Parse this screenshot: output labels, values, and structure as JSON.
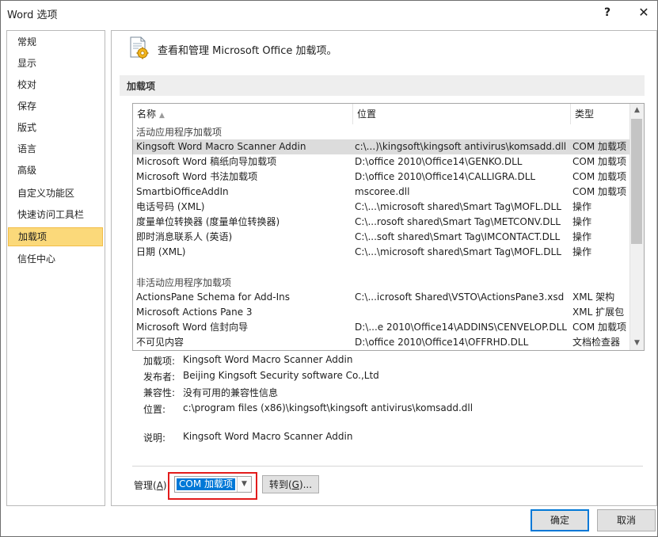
{
  "window": {
    "title": "Word 选项",
    "help": "?",
    "close": "✕"
  },
  "sidebar": {
    "items": [
      {
        "label": "常规"
      },
      {
        "label": "显示"
      },
      {
        "label": "校对"
      },
      {
        "label": "保存"
      },
      {
        "label": "版式"
      },
      {
        "label": "语言"
      },
      {
        "label": "高级"
      },
      {
        "label": "自定义功能区"
      },
      {
        "label": "快速访问工具栏"
      },
      {
        "label": "加载项",
        "selected": true
      },
      {
        "label": "信任中心"
      }
    ]
  },
  "header": {
    "text": "查看和管理 Microsoft Office 加载项。"
  },
  "section": {
    "title": "加载项"
  },
  "table": {
    "columns": {
      "name": "名称",
      "sort_arrow": "▲",
      "location": "位置",
      "type": "类型"
    },
    "groups": [
      {
        "label": "活动应用程序加载项",
        "rows": [
          {
            "name": "Kingsoft Word Macro Scanner Addin",
            "location": "c:\\...)\\kingsoft\\kingsoft antivirus\\komsadd.dll",
            "type": "COM 加载项",
            "highlighted": true
          },
          {
            "name": "Microsoft Word 稿纸向导加载项",
            "location": "D:\\office 2010\\Office14\\GENKO.DLL",
            "type": "COM 加载项"
          },
          {
            "name": "Microsoft Word 书法加载项",
            "location": "D:\\office 2010\\Office14\\CALLIGRA.DLL",
            "type": "COM 加载项"
          },
          {
            "name": "SmartbiOfficeAddIn",
            "location": "mscoree.dll",
            "type": "COM 加载项"
          },
          {
            "name": "电话号码 (XML)",
            "location": "C:\\...\\microsoft shared\\Smart Tag\\MOFL.DLL",
            "type": "操作"
          },
          {
            "name": "度量单位转换器 (度量单位转换器)",
            "location": "C:\\...rosoft shared\\Smart Tag\\METCONV.DLL",
            "type": "操作"
          },
          {
            "name": "即时消息联系人 (英语)",
            "location": "C:\\...soft shared\\Smart Tag\\IMCONTACT.DLL",
            "type": "操作"
          },
          {
            "name": "日期 (XML)",
            "location": "C:\\...\\microsoft shared\\Smart Tag\\MOFL.DLL",
            "type": "操作"
          }
        ]
      },
      {
        "label": "非活动应用程序加载项",
        "rows": [
          {
            "name": "ActionsPane Schema for Add-Ins",
            "location": "C:\\...icrosoft Shared\\VSTO\\ActionsPane3.xsd",
            "type": "XML 架构"
          },
          {
            "name": "Microsoft Actions Pane 3",
            "location": "",
            "type": "XML 扩展包"
          },
          {
            "name": "Microsoft Word 信封向导",
            "location": "D:\\...e 2010\\Office14\\ADDINS\\CENVELOP.DLL",
            "type": "COM 加载项"
          },
          {
            "name": "不可见内容",
            "location": "D:\\office 2010\\Office14\\OFFRHD.DLL",
            "type": "文档检查器"
          }
        ]
      }
    ]
  },
  "details": {
    "addin_label": "加载项:",
    "addin": "Kingsoft Word Macro Scanner Addin",
    "publisher_label": "发布者:",
    "publisher": "Beijing Kingsoft Security software Co.,Ltd",
    "compat_label": "兼容性:",
    "compat": "没有可用的兼容性信息",
    "location_label": "位置:",
    "location": "c:\\program files (x86)\\kingsoft\\kingsoft antivirus\\komsadd.dll",
    "desc_label": "说明:",
    "desc": "Kingsoft Word Macro Scanner Addin"
  },
  "manage": {
    "label": "管理(A):",
    "label_main": "管理(",
    "label_key": "A",
    "label_end": "):",
    "selected": "COM 加载项",
    "goto": "转到(G)...",
    "goto_main": "转到(",
    "goto_key": "G",
    "goto_end": ")..."
  },
  "buttons": {
    "ok": "确定",
    "cancel": "取消"
  },
  "colors": {
    "selection": "#fbd97a",
    "highlight_box": "#e21b1b",
    "combo_selection": "#0078d7"
  }
}
